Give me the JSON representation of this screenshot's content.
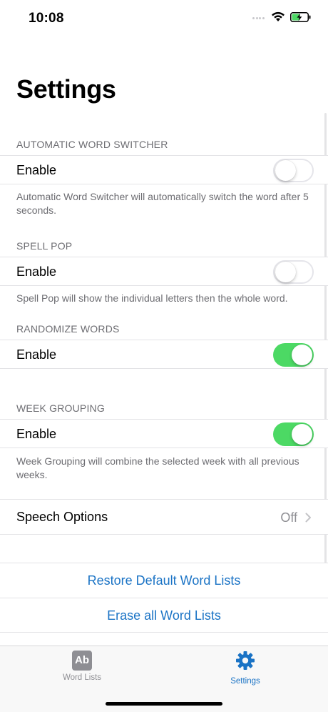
{
  "status_bar": {
    "time": "10:08"
  },
  "page": {
    "title": "Settings"
  },
  "sections": {
    "auto_switcher": {
      "header": "AUTOMATIC WORD SWITCHER",
      "label": "Enable",
      "footer": "Automatic Word Switcher will automatically switch the word after 5 seconds.",
      "enabled": false
    },
    "spell_pop": {
      "header": "SPELL POP",
      "label": "Enable",
      "footer": "Spell Pop will show the individual letters then the whole word.",
      "enabled": false
    },
    "randomize": {
      "header": "RANDOMIZE WORDS",
      "label": "Enable",
      "enabled": true
    },
    "week_grouping": {
      "header": "WEEK GROUPING",
      "label": "Enable",
      "footer": "Week Grouping will combine the selected week with all previous weeks.",
      "enabled": true
    },
    "speech": {
      "label": "Speech Options",
      "value": "Off"
    }
  },
  "actions": {
    "restore": "Restore Default Word Lists",
    "erase": "Erase all Word Lists"
  },
  "tab_bar": {
    "word_lists": {
      "icon_text": "Ab",
      "label": "Word Lists"
    },
    "settings": {
      "label": "Settings"
    }
  },
  "colors": {
    "accent": "#1a73c5",
    "toggle_on": "#4cd964",
    "secondary_text": "#6d6d72",
    "tab_inactive": "#8e8e93"
  }
}
